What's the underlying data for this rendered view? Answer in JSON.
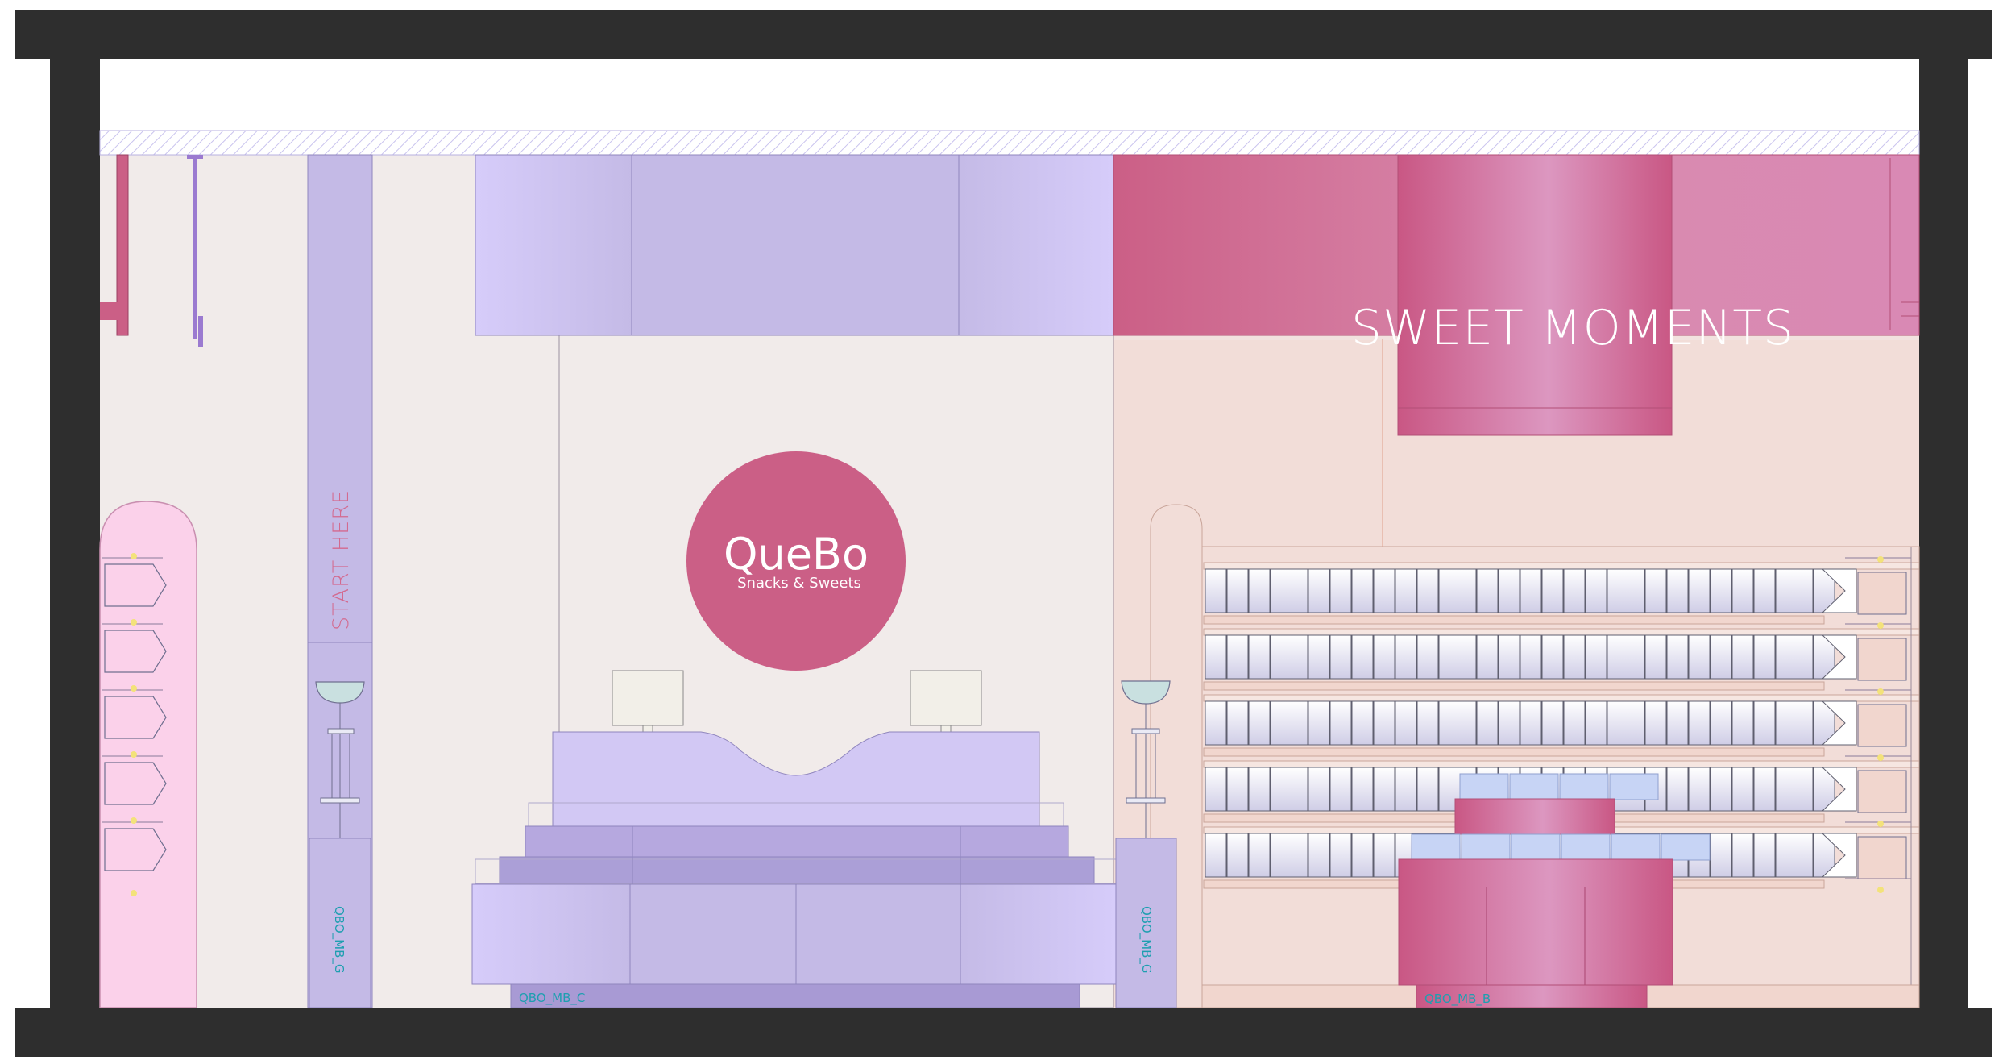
{
  "drawing": {
    "banner_text": "SWEET MOMENTS",
    "column_sign_text": "START HERE",
    "logo": {
      "brand": "QueBo",
      "tagline": "Snacks & Sweets"
    },
    "unit_codes": {
      "left_column_unit": "QBO_MB_G",
      "reception_counter": "QBO_MB_C",
      "right_column_unit": "QBO_MB_G",
      "tiered_display": "QBO_MB_B"
    },
    "colors": {
      "frame": "#2e2e2e",
      "wall": "#f1ebea",
      "wall_right": "#f2ddd8",
      "lavender": "#c4bae6",
      "lavender_light": "#d2c8f4",
      "magenta": "#cb5f86",
      "magenta_light": "#d989b4",
      "pink_cabinet": "#fbd1ea",
      "peach": "#f1d6ce",
      "code_text": "#1e9fb0",
      "sign_text": "#d36a8f"
    }
  }
}
